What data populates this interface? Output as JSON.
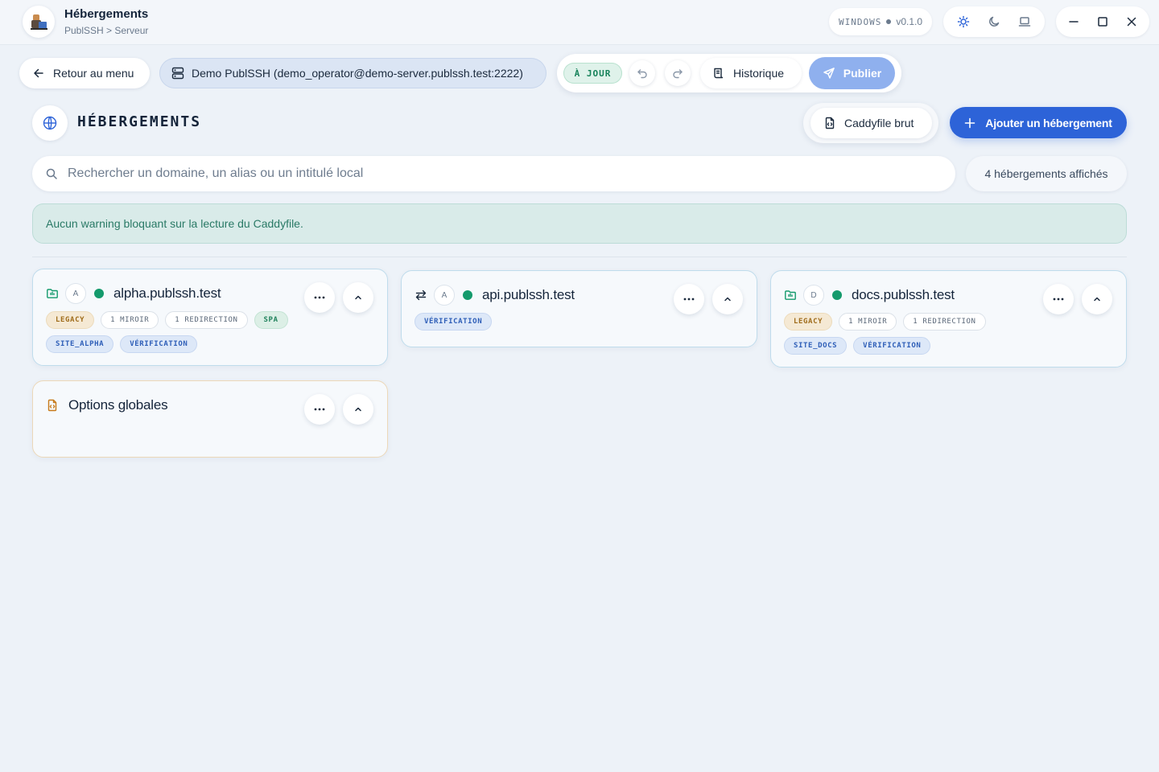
{
  "titlebar": {
    "title": "Hébergements",
    "breadcrumb": "PublSSH > Serveur",
    "platform": "WINDOWS",
    "version": "v0.1.0"
  },
  "toolbar": {
    "back_label": "Retour au menu",
    "server_label": "Demo PublSSH (demo_operator@demo-server.publssh.test:2222)",
    "status_label": "À JOUR",
    "history_label": "Historique",
    "publish_label": "Publier"
  },
  "section": {
    "title": "HÉBERGEMENTS",
    "caddyfile_label": "Caddyfile brut",
    "add_label": "Ajouter un hébergement"
  },
  "search": {
    "placeholder": "Rechercher un domaine, un alias ou un intitulé local",
    "value": "",
    "count_label": "4 hébergements affichés"
  },
  "banner": {
    "text": "Aucun warning bloquant sur la lecture du Caddyfile."
  },
  "cards": [
    {
      "letter": "A",
      "domain": "alpha.publssh.test",
      "tags_row1": [
        "LEGACY",
        "1 MIROIR",
        "1 REDIRECTION",
        "SPA"
      ],
      "tags_row2": [
        "SITE_ALPHA",
        "VÉRIFICATION"
      ]
    },
    {
      "letter": "A",
      "domain": "api.publssh.test",
      "tags_row1": [
        "VÉRIFICATION"
      ]
    },
    {
      "letter": "D",
      "domain": "docs.publssh.test",
      "tags_row1": [
        "LEGACY",
        "1 MIROIR",
        "1 REDIRECTION"
      ],
      "tags_row2": [
        "SITE_DOCS",
        "VÉRIFICATION"
      ]
    },
    {
      "domain": "Options globales"
    }
  ],
  "colors": {
    "accent": "#2d63d8",
    "publish": "#8fb0ee",
    "status_ok": "#149a6c",
    "banner_bg": "#d9ebe9"
  }
}
